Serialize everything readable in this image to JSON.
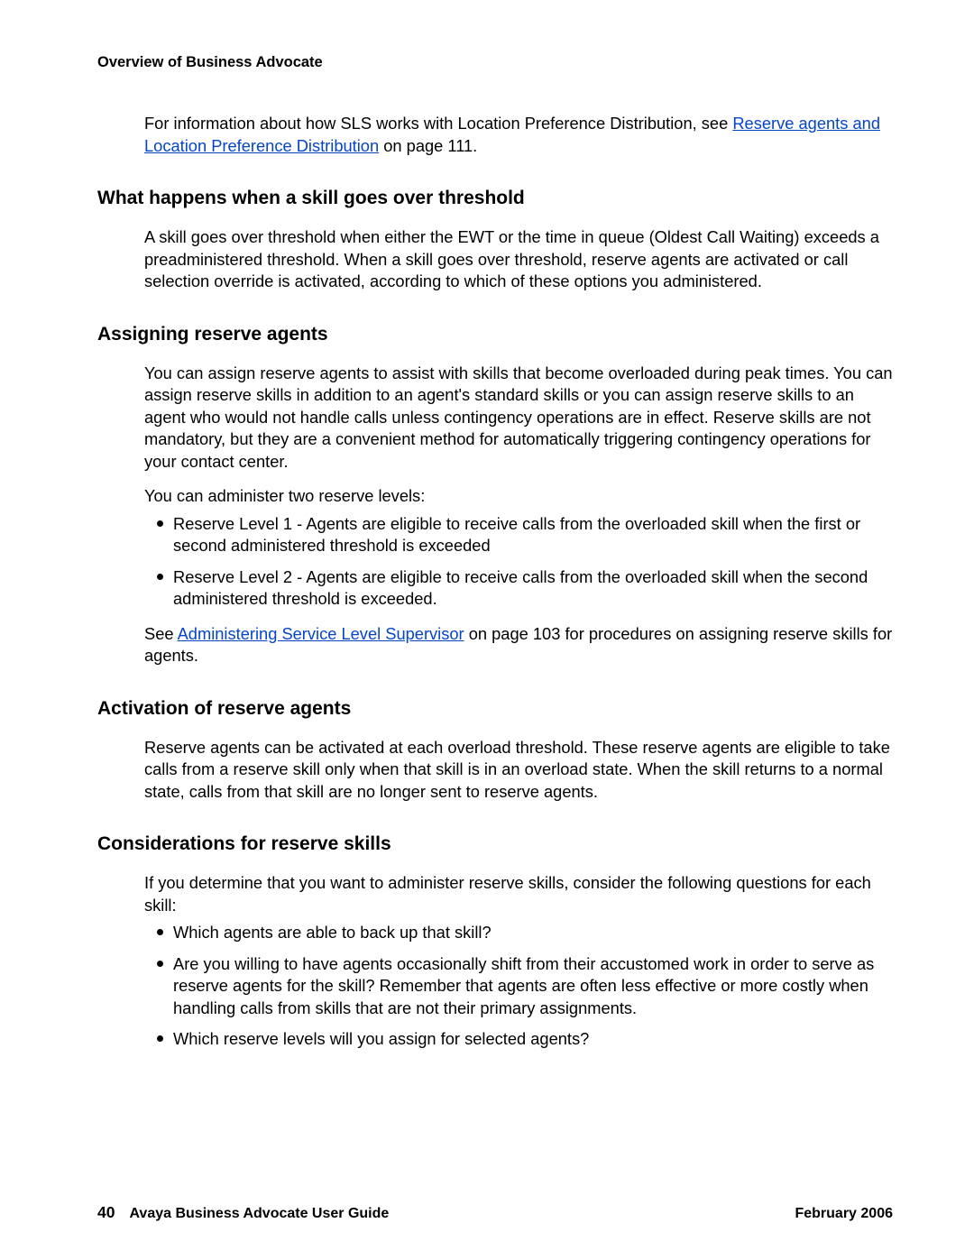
{
  "running_header": "Overview of Business Advocate",
  "intro": {
    "prefix": "For information about how SLS works with Location Preference Distribution, see ",
    "link": "Reserve agents and Location Preference Distribution",
    "suffix": " on page 111."
  },
  "sections": {
    "threshold": {
      "heading": "What happens when a skill goes over threshold",
      "para": "A skill goes over threshold when either the EWT or the time in queue (Oldest Call Waiting) exceeds a preadministered threshold. When a skill goes over threshold, reserve agents are activated or call selection override is activated, according to which of these options you administered."
    },
    "assigning": {
      "heading": "Assigning reserve agents",
      "para1": "You can assign reserve agents to assist with skills that become overloaded during peak times. You can assign reserve skills in addition to an agent's standard skills or you can assign reserve skills to an agent who would not handle calls unless contingency operations are in effect. Reserve skills are not mandatory, but they are a convenient method for automatically triggering contingency operations for your contact center.",
      "para2": "You can administer two reserve levels:",
      "bullets": [
        "Reserve Level 1 - Agents are eligible to receive calls from the overloaded skill when the first or second administered threshold is exceeded",
        "Reserve Level 2 - Agents are eligible to receive calls from the overloaded skill when the second administered threshold is exceeded."
      ],
      "closing_prefix": "See ",
      "closing_link": "Administering Service Level Supervisor",
      "closing_suffix": " on page 103 for procedures on assigning reserve skills for agents."
    },
    "activation": {
      "heading": "Activation of reserve agents",
      "para": "Reserve agents can be activated at each overload threshold. These reserve agents are eligible to take calls from a reserve skill only when that skill is in an overload state. When the skill returns to a normal state, calls from that skill are no longer sent to reserve agents."
    },
    "considerations": {
      "heading": "Considerations for reserve skills",
      "para": "If you determine that you want to administer reserve skills, consider the following questions for each skill:",
      "bullets": [
        "Which agents are able to back up that skill?",
        "Are you willing to have agents occasionally shift from their accustomed work in order to serve as reserve agents for the skill? Remember that agents are often less effective or more costly when handling calls from skills that are not their primary assignments.",
        "Which reserve levels will you assign for selected agents?"
      ]
    }
  },
  "footer": {
    "page_number": "40",
    "guide_title": "Avaya Business Advocate User Guide",
    "date": "February 2006"
  }
}
